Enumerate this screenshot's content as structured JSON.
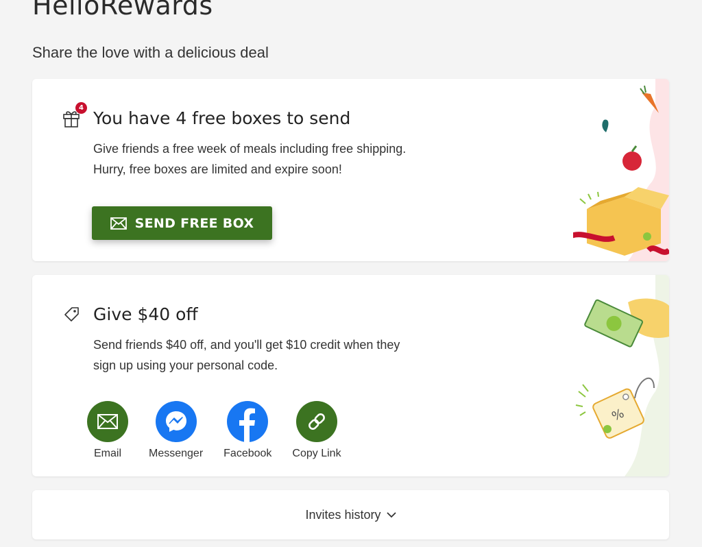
{
  "page": {
    "title": "HelloRewards",
    "subtitle": "Share the love with a delicious deal"
  },
  "free_boxes": {
    "badge": "4",
    "title": "You have 4 free boxes to send",
    "description": "Give friends a free week of meals including free shipping. Hurry, free boxes are limited and expire soon!",
    "button_label": "SEND FREE BOX",
    "icon": "gift-icon"
  },
  "discount": {
    "title": "Give $40 off",
    "description": "Send friends $40 off, and you'll get $10 credit when they sign up using your personal code.",
    "icon": "tag-icon",
    "share_options": [
      {
        "label": "Email",
        "icon": "envelope-icon",
        "color": "#3c7321"
      },
      {
        "label": "Messenger",
        "icon": "messenger-icon",
        "color": "#1877f2"
      },
      {
        "label": "Facebook",
        "icon": "facebook-icon",
        "color": "#1877f2"
      },
      {
        "label": "Copy Link",
        "icon": "link-icon",
        "color": "#3c7321"
      }
    ]
  },
  "invites": {
    "label": "Invites history"
  },
  "colors": {
    "brand_green": "#3c7321",
    "badge_red": "#c8102e",
    "facebook_blue": "#1877f2"
  }
}
